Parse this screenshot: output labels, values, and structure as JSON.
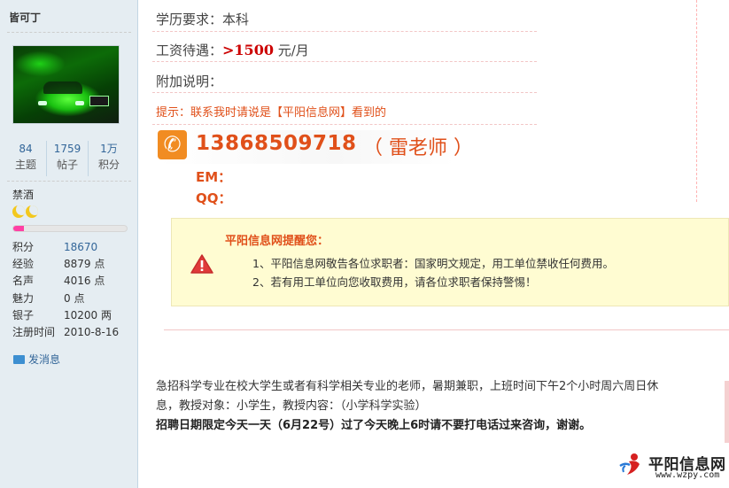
{
  "sidebar": {
    "username": "皆可丁",
    "stats": [
      {
        "num": "84",
        "label": "主题"
      },
      {
        "num": "1759",
        "label": "帖子"
      },
      {
        "num": "1万",
        "label": "积分"
      }
    ],
    "group": "禁酒",
    "group_stars_icon": "moon-icon",
    "progress_fraction": 0.09,
    "progress_color": "#ff3fa4",
    "info": [
      {
        "key": "积分",
        "value": "18670"
      },
      {
        "key": "经验",
        "value": "8879 点"
      },
      {
        "key": "名声",
        "value": "4016 点"
      },
      {
        "key": "魅力",
        "value": "0 点"
      },
      {
        "key": "银子",
        "value": "10200 两"
      },
      {
        "key": "注册时间",
        "value": "2010-8-16"
      }
    ],
    "send_message": "发消息"
  },
  "post": {
    "education": "学历要求：本科",
    "salary_label": "工资待遇：",
    "salary_value": ">1500",
    "salary_unit": " 元/月",
    "extra": "附加说明：",
    "hint": "提示：联系我时请说是【平阳信息网】看到的",
    "phone": "13868509718",
    "contact_name": "（ 雷老师 ）",
    "em_label": "EM：",
    "qq_label": "QQ："
  },
  "notice": {
    "title": "平阳信息网提醒您：",
    "items": [
      "1、平阳信息网敬告各位求职者：国家明文规定，用工单位禁收任何费用。",
      "2、若有用工单位向您收取费用，请各位求职者保持警惕！"
    ]
  },
  "content": {
    "line1": "急招科学专业在校大学生或者有科学相关专业的老师，暑期兼职，上班时间下午2个小时周六周日休",
    "line2": "息，教授对象：小学生，教授内容：（小学科学实验）",
    "line3": "招聘日期限定今天一天（6月22号）过了今天晚上6时请不要打电话过来咨询，谢谢。"
  },
  "watermark": {
    "title": "平阳信息网",
    "url": "www.wzpy.com"
  },
  "colors": {
    "accent_orange": "#e0501a",
    "link_blue": "#336699",
    "notice_bg": "#fffcd2",
    "sidebar_bg": "#e5edf2"
  }
}
